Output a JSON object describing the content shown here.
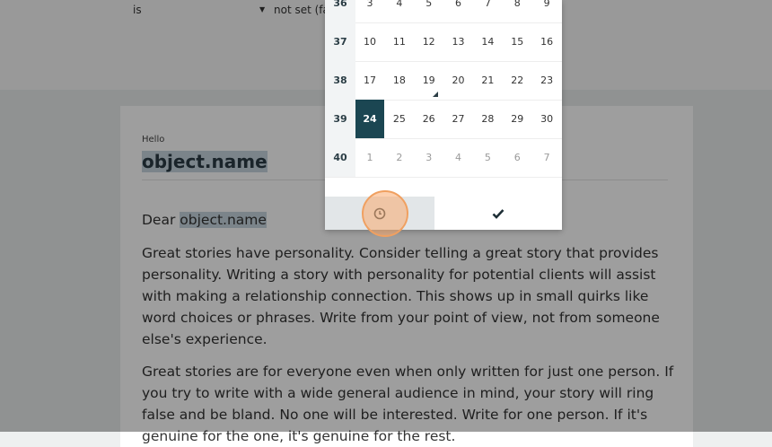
{
  "filter": {
    "operator": "is",
    "value": "not set (fa"
  },
  "document": {
    "hello_label": "Hello",
    "title": "object.name",
    "greeting_prefix": "Dear ",
    "greeting_var": "object.name",
    "paragraphs": [
      "Great stories have personality. Consider telling a great story that provides personality. Writing a story with personality for potential clients will assist with making a relationship connection. This shows up in small quirks like word choices or phrases. Write from your point of view, not from someone else's experience.",
      "Great stories are for everyone even when only written for just one person. If you try to write with a wide general audience in mind, your story will ring false and be bland. No one will be interested. Write for one person. If it's genuine for the one, it's genuine for the rest."
    ]
  },
  "calendar": {
    "weeks": [
      {
        "week": "36",
        "days": [
          "3",
          "4",
          "5",
          "6",
          "7",
          "8",
          "9"
        ]
      },
      {
        "week": "37",
        "days": [
          "10",
          "11",
          "12",
          "13",
          "14",
          "15",
          "16"
        ]
      },
      {
        "week": "38",
        "days": [
          "17",
          "18",
          "19",
          "20",
          "21",
          "22",
          "23"
        ]
      },
      {
        "week": "39",
        "days": [
          "24",
          "25",
          "26",
          "27",
          "28",
          "29",
          "30"
        ]
      },
      {
        "week": "40",
        "days": [
          "1",
          "2",
          "3",
          "4",
          "5",
          "6",
          "7"
        ]
      }
    ],
    "selected_day": "24",
    "today_day": "19",
    "colors": {
      "selected_bg": "#1b4652",
      "week_col_bg": "#f2f4f5"
    },
    "footer": {
      "time_icon": "clock-icon",
      "confirm_icon": "checkmark-icon"
    }
  }
}
